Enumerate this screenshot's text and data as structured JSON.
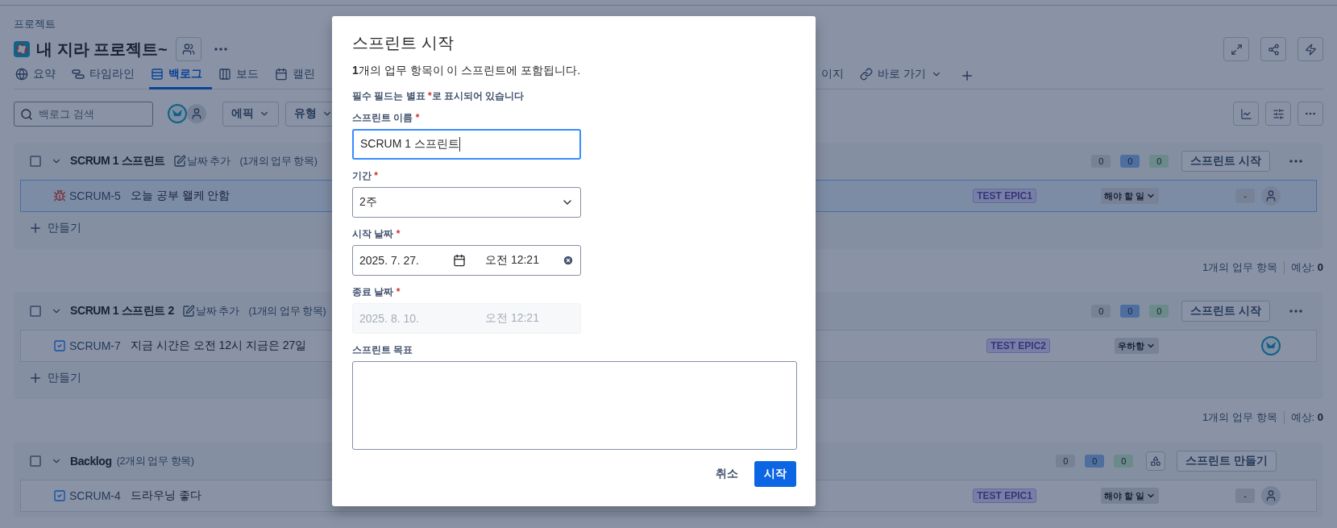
{
  "breadcrumb": "프로젝트",
  "project": {
    "title": "내 지라 프로젝트~"
  },
  "tabs": [
    {
      "label": "요약",
      "selected": false,
      "menu": false
    },
    {
      "label": "타임라인",
      "selected": false,
      "menu": false
    },
    {
      "label": "백로그",
      "selected": true,
      "menu": false
    },
    {
      "label": "보드",
      "selected": false,
      "menu": false
    },
    {
      "label": "캘린",
      "selected": false,
      "menu": false
    },
    {
      "label": "이지",
      "selected": false,
      "menu": false
    },
    {
      "label": "바로 가기",
      "selected": false,
      "menu": true
    }
  ],
  "search": {
    "placeholder": "백로그 검색"
  },
  "filters": [
    {
      "label": "에픽"
    },
    {
      "label": "유형"
    }
  ],
  "sprints": [
    {
      "kind": "sprint",
      "name": "SCRUM 1 스프린트",
      "checked": false,
      "expanded": true,
      "add_date": "날짜 추가",
      "count": "(1개의 업무 항목)",
      "counts": [
        {
          "kind": "todo",
          "value": "0"
        },
        {
          "kind": "progress",
          "value": "0"
        },
        {
          "kind": "done",
          "value": "0"
        }
      ],
      "action": "스프린트 시작",
      "issues": [
        {
          "kind": "bug",
          "key": "SCRUM-5",
          "summary": "오늘 공부 왤케 안함",
          "epic": "TEST EPIC1",
          "status": "해야 할 일",
          "estimate": "-",
          "assigned": false,
          "selected": true
        }
      ],
      "create": "만들기",
      "summary": "1개의 업무 항목",
      "estimate_label": "예상:",
      "estimate": "0"
    },
    {
      "kind": "sprint",
      "name": "SCRUM 1 스프린트 2",
      "checked": false,
      "expanded": true,
      "add_date": "날짜 추가",
      "count": "(1개의 업무 항목)",
      "counts": [
        {
          "kind": "todo",
          "value": "0"
        },
        {
          "kind": "progress",
          "value": "0"
        },
        {
          "kind": "done",
          "value": "0"
        }
      ],
      "action": "스프린트 시작",
      "issues": [
        {
          "kind": "task",
          "key": "SCRUM-7",
          "summary": "지금 시간은 오전 12시 지금은 27일",
          "epic": "TEST EPIC2",
          "status": "우하항",
          "assigned": true,
          "selected": false
        }
      ],
      "create": "만들기",
      "summary": "1개의 업무 항목",
      "estimate_label": "예상:",
      "estimate": "0"
    },
    {
      "kind": "backlog",
      "name": "Backlog",
      "checked": false,
      "expanded": true,
      "count": "(2개의 업무 항목)",
      "counts": [
        {
          "kind": "todo",
          "value": "0"
        },
        {
          "kind": "progress",
          "value": "0"
        },
        {
          "kind": "done",
          "value": "0"
        }
      ],
      "action": "스프린트 만들기",
      "issues": [
        {
          "kind": "task",
          "key": "SCRUM-4",
          "summary": "드라우닝 좋다",
          "epic": "TEST EPIC1",
          "status": "해야 할 일",
          "estimate": "-",
          "assigned": false,
          "selected": false
        }
      ]
    }
  ],
  "modal": {
    "title": "스프린트 시작",
    "intro": "**1**개의 업무 항목이 이 스프린트에 포함됩니다.",
    "note_before": "필수 필드는 별표 ",
    "required_mark": "*",
    "note_after": "로 표시되어 있습니다",
    "fields": [
      {
        "kind": "text",
        "label": "스프린트 이름",
        "required": true,
        "value": "SCRUM 1 스프린트",
        "focused": true
      },
      {
        "kind": "select",
        "label": "기간",
        "required": true,
        "value": "2주"
      },
      {
        "kind": "datetime",
        "label": "시작 날짜",
        "required": true,
        "date": "2025. 7. 27.",
        "time": "오전 12:21",
        "disabled": false
      },
      {
        "kind": "datetime",
        "label": "종료 날짜",
        "required": true,
        "date": "2025. 8. 10.",
        "time": "오전 12:21",
        "disabled": true
      },
      {
        "kind": "textarea",
        "label": "스프린트 목표",
        "required": false
      }
    ],
    "cancel": "취소",
    "confirm": "시작"
  }
}
